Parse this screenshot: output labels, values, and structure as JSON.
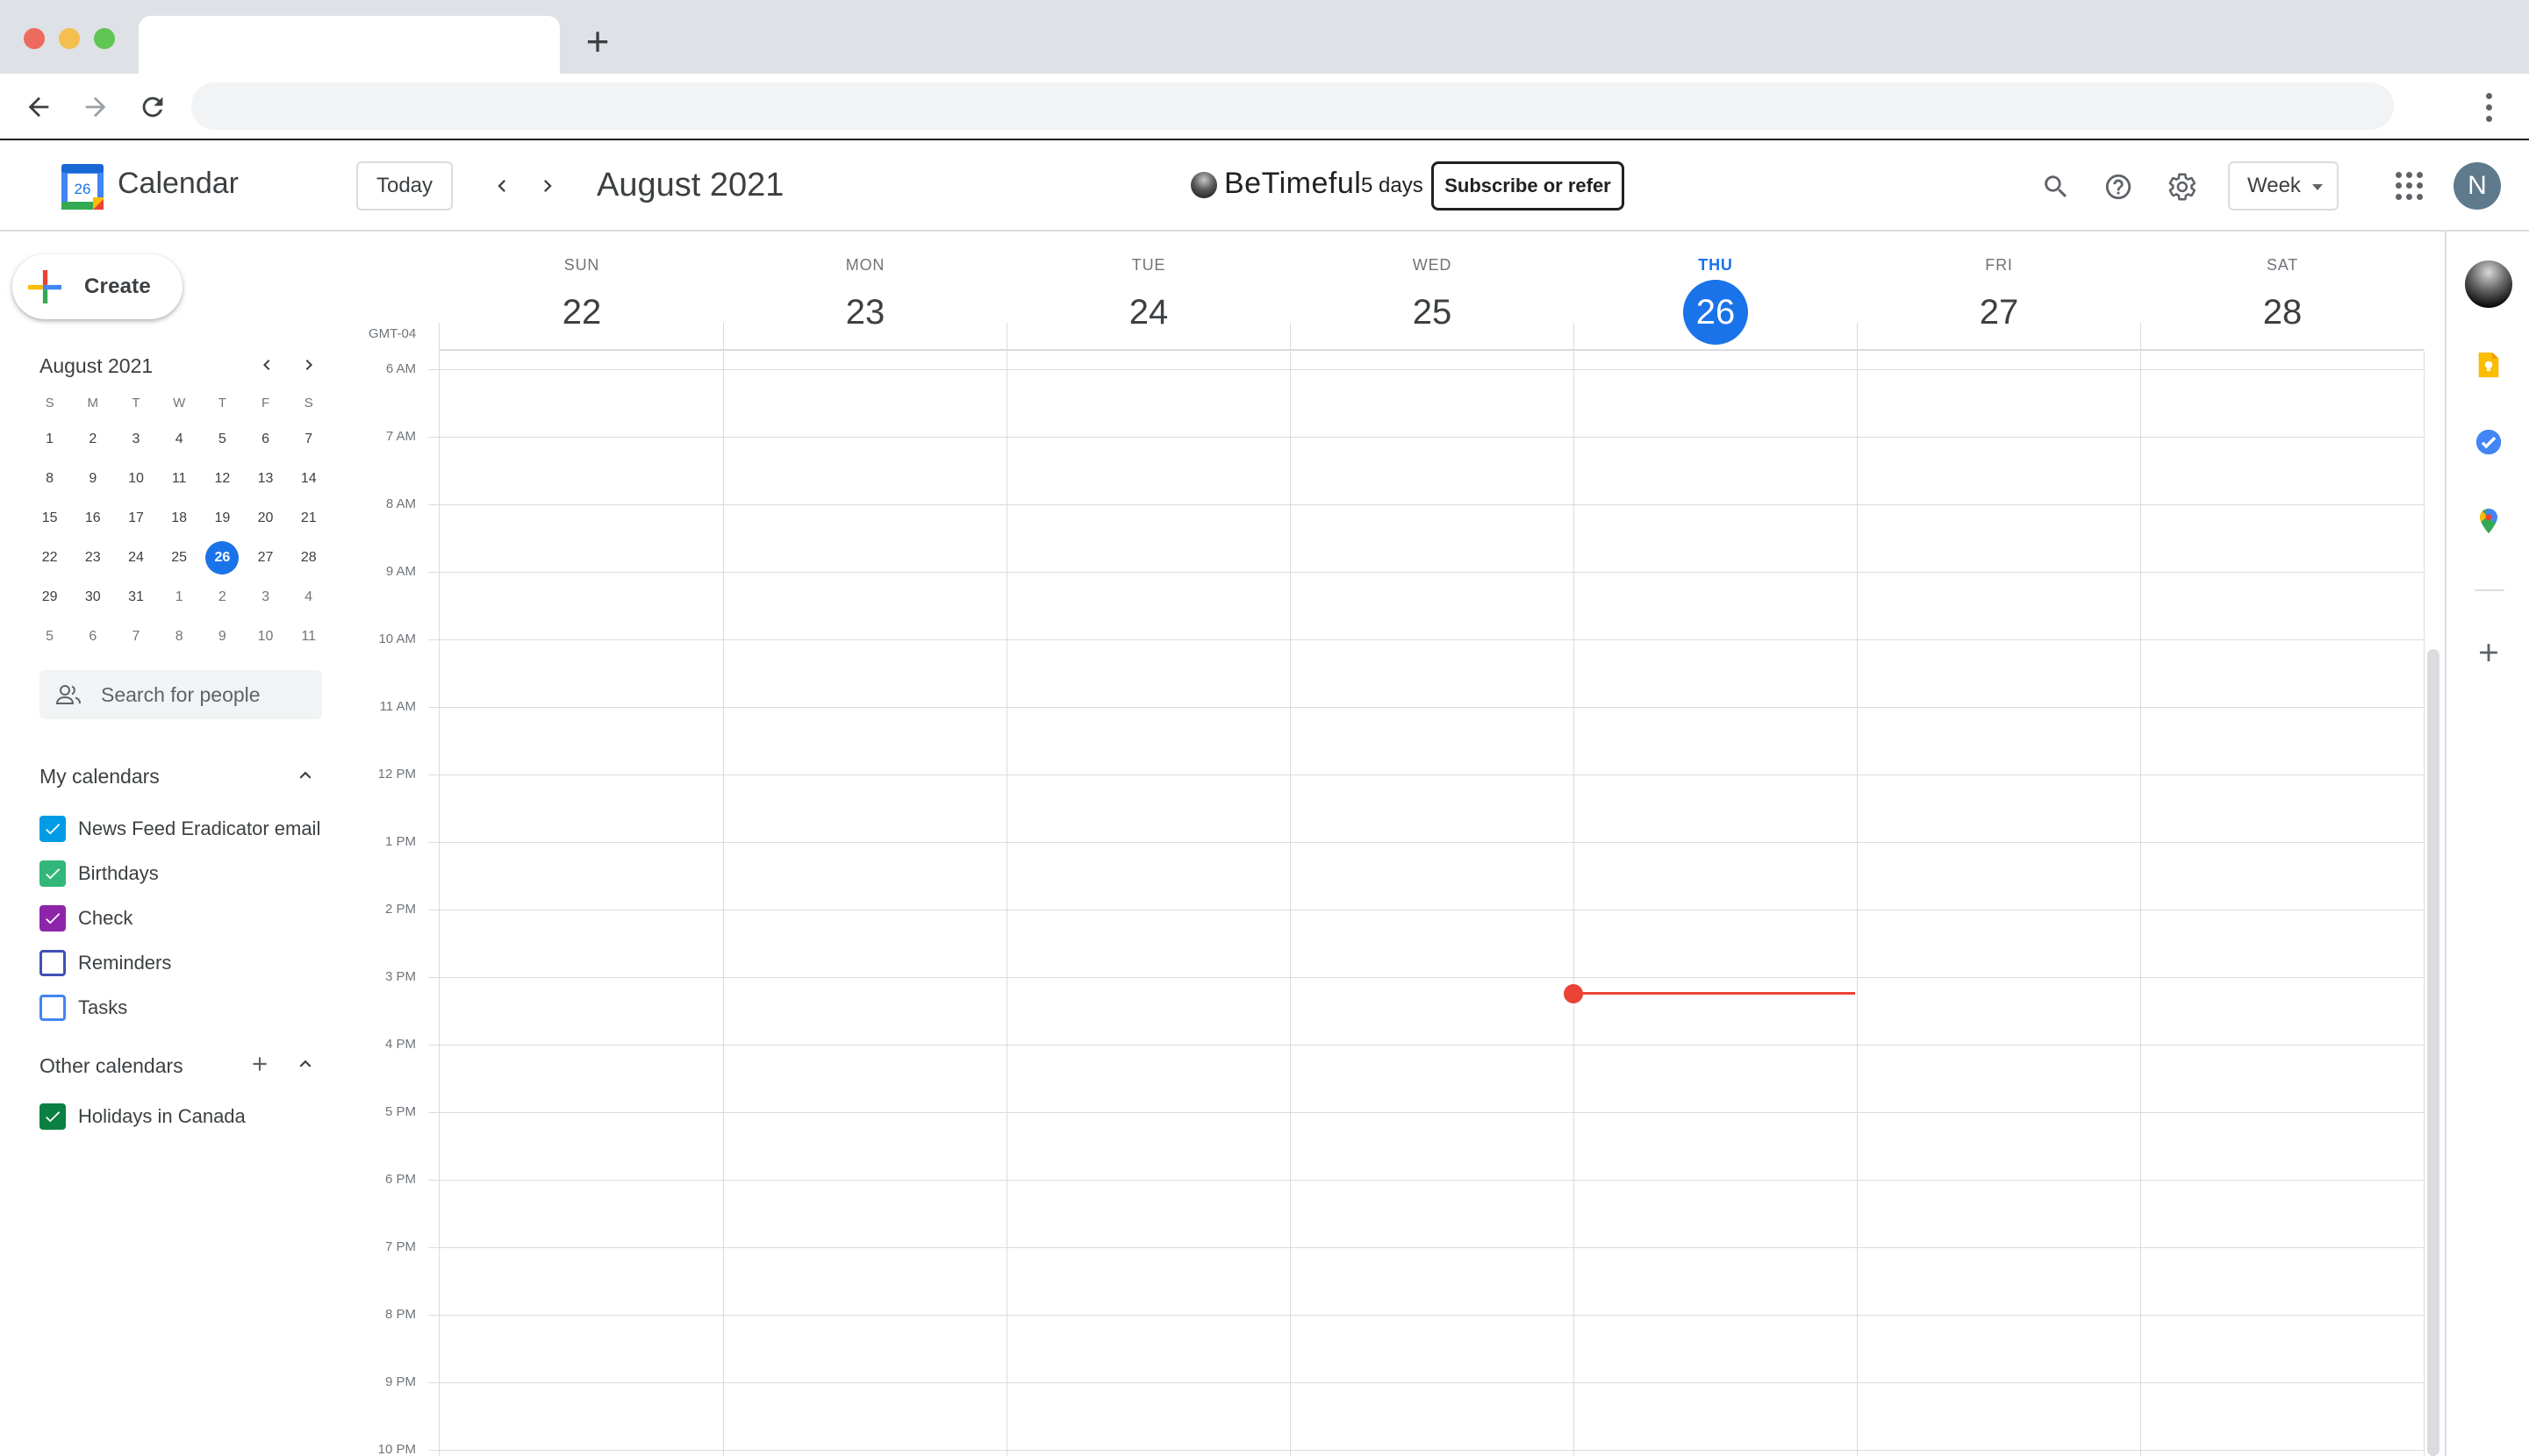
{
  "app": {
    "title": "Calendar",
    "logo_number": "26",
    "today_label": "Today",
    "period": "August 2021",
    "view": "Week",
    "avatar_initial": "N",
    "accent_color": "#1a73e8"
  },
  "promo": {
    "brand": "BeTimeful",
    "days": "5 days",
    "button": "Subscribe or refer"
  },
  "sidebar": {
    "create_label": "Create",
    "mini_month": "August 2021",
    "weekday_heads": [
      "S",
      "M",
      "T",
      "W",
      "T",
      "F",
      "S"
    ],
    "weeks": [
      [
        "1",
        "2",
        "3",
        "4",
        "5",
        "6",
        "7"
      ],
      [
        "8",
        "9",
        "10",
        "11",
        "12",
        "13",
        "14"
      ],
      [
        "15",
        "16",
        "17",
        "18",
        "19",
        "20",
        "21"
      ],
      [
        "22",
        "23",
        "24",
        "25",
        "26",
        "27",
        "28"
      ],
      [
        "29",
        "30",
        "31",
        "1",
        "2",
        "3",
        "4"
      ],
      [
        "5",
        "6",
        "7",
        "8",
        "9",
        "10",
        "11"
      ]
    ],
    "search_placeholder": "Search for people",
    "my_calendars_title": "My calendars",
    "my_calendars": [
      {
        "label": "News Feed Eradicator email",
        "color": "#039be5",
        "checked": true
      },
      {
        "label": "Birthdays",
        "color": "#33b679",
        "checked": true
      },
      {
        "label": "Check",
        "color": "#8e24aa",
        "checked": true
      },
      {
        "label": "Reminders",
        "color": "#3f51b5",
        "checked": false
      },
      {
        "label": "Tasks",
        "color": "#4285f4",
        "checked": false
      }
    ],
    "other_calendars_title": "Other calendars",
    "other_calendars": [
      {
        "label": "Holidays in Canada",
        "color": "#0b8043",
        "checked": true
      }
    ]
  },
  "week": {
    "timezone": "GMT-04",
    "days": [
      {
        "dow": "SUN",
        "date": "22",
        "today": false
      },
      {
        "dow": "MON",
        "date": "23",
        "today": false
      },
      {
        "dow": "TUE",
        "date": "24",
        "today": false
      },
      {
        "dow": "WED",
        "date": "25",
        "today": false
      },
      {
        "dow": "THU",
        "date": "26",
        "today": true
      },
      {
        "dow": "FRI",
        "date": "27",
        "today": false
      },
      {
        "dow": "SAT",
        "date": "28",
        "today": false
      }
    ],
    "hours": [
      "6 AM",
      "7 AM",
      "8 AM",
      "9 AM",
      "10 AM",
      "11 AM",
      "12 PM",
      "1 PM",
      "2 PM",
      "3 PM",
      "4 PM",
      "5 PM",
      "6 PM",
      "7 PM",
      "8 PM",
      "9 PM",
      "10 PM"
    ],
    "current_time_marker_color": "#ea4335"
  }
}
